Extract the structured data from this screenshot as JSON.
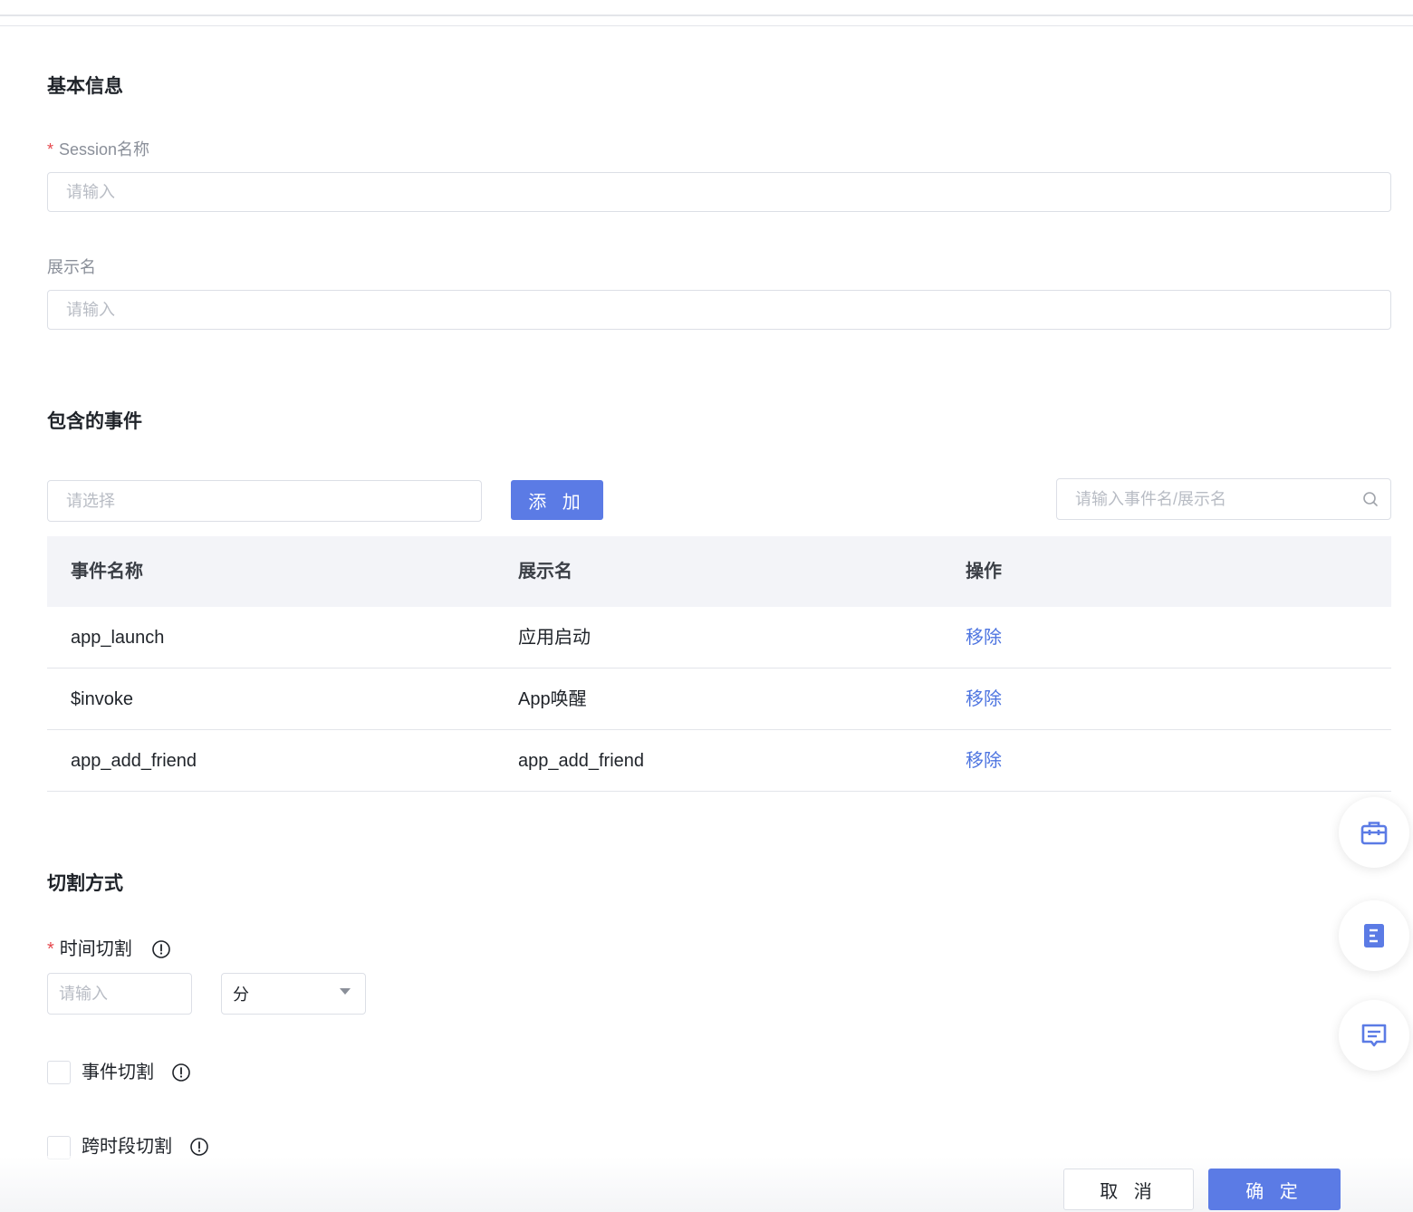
{
  "basic_info": {
    "title": "基本信息",
    "session_name": {
      "label": "Session名称",
      "required_mark": "*",
      "placeholder": "请输入",
      "value": ""
    },
    "display_name": {
      "label": "展示名",
      "placeholder": "请输入",
      "value": ""
    }
  },
  "events": {
    "title": "包含的事件",
    "select_placeholder": "请选择",
    "add_label": "添 加",
    "search_placeholder": "请输入事件名/展示名",
    "columns": [
      "事件名称",
      "展示名",
      "操作"
    ],
    "rows": [
      {
        "name": "app_launch",
        "display": "应用启动",
        "action": "移除"
      },
      {
        "name": "$invoke",
        "display": "App唤醒",
        "action": "移除"
      },
      {
        "name": "app_add_friend",
        "display": "app_add_friend",
        "action": "移除"
      }
    ]
  },
  "split": {
    "title": "切割方式",
    "time_split": {
      "label": "时间切割",
      "required_mark": "*",
      "placeholder": "请输入",
      "unit": "分"
    },
    "event_split": {
      "label": "事件切割",
      "checked": false
    },
    "cross_period_split": {
      "label": "跨时段切割",
      "checked": false
    }
  },
  "footer": {
    "cancel_label": "取 消",
    "confirm_label": "确 定"
  },
  "colors": {
    "primary": "#5b7be5",
    "link": "#4d74e0",
    "required": "#e5484d",
    "header_bg": "#f3f4f8"
  },
  "float_actions": [
    "toolbox-icon",
    "document-icon",
    "feedback-icon"
  ]
}
